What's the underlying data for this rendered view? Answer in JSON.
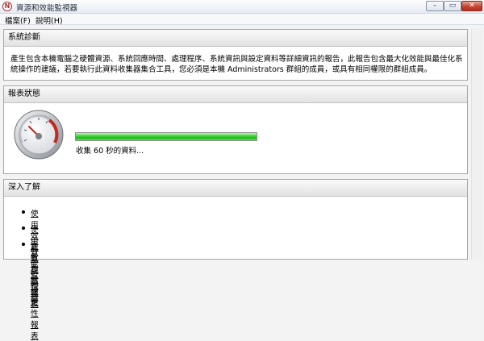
{
  "window": {
    "title": "資源和效能監視器",
    "app_icon_glyph": "N",
    "minimize_glyph": "–",
    "maximize_glyph": "▭",
    "close_glyph": "✕"
  },
  "menu": {
    "file": "檔案(F)",
    "help": "說明(H)"
  },
  "diagnostics": {
    "title": "系統診斷",
    "description": "產生包含本機電腦之硬體資源、系統回應時間、處理程序、系統資訊與設定資料等詳細資訊的報告，此報告包含最大化效能與最佳化系統操作的建議，若要執行此資料收集器集合工具，您必須是本機 Administrators 群組的成員，或具有相同權限的群組成員。"
  },
  "report_status": {
    "title": "報表狀態",
    "progress_fraction": 1.0,
    "status_text": "收集 60 秒的資料..."
  },
  "learn_more": {
    "title": "深入了解",
    "links": [
      "使用效能監視器報表",
      "使用效能監視器",
      "查看系統穩定性報表"
    ]
  },
  "colors": {
    "progress_green": "#22b51d",
    "gauge_red": "#c4281f",
    "close_red": "#c7412e"
  }
}
